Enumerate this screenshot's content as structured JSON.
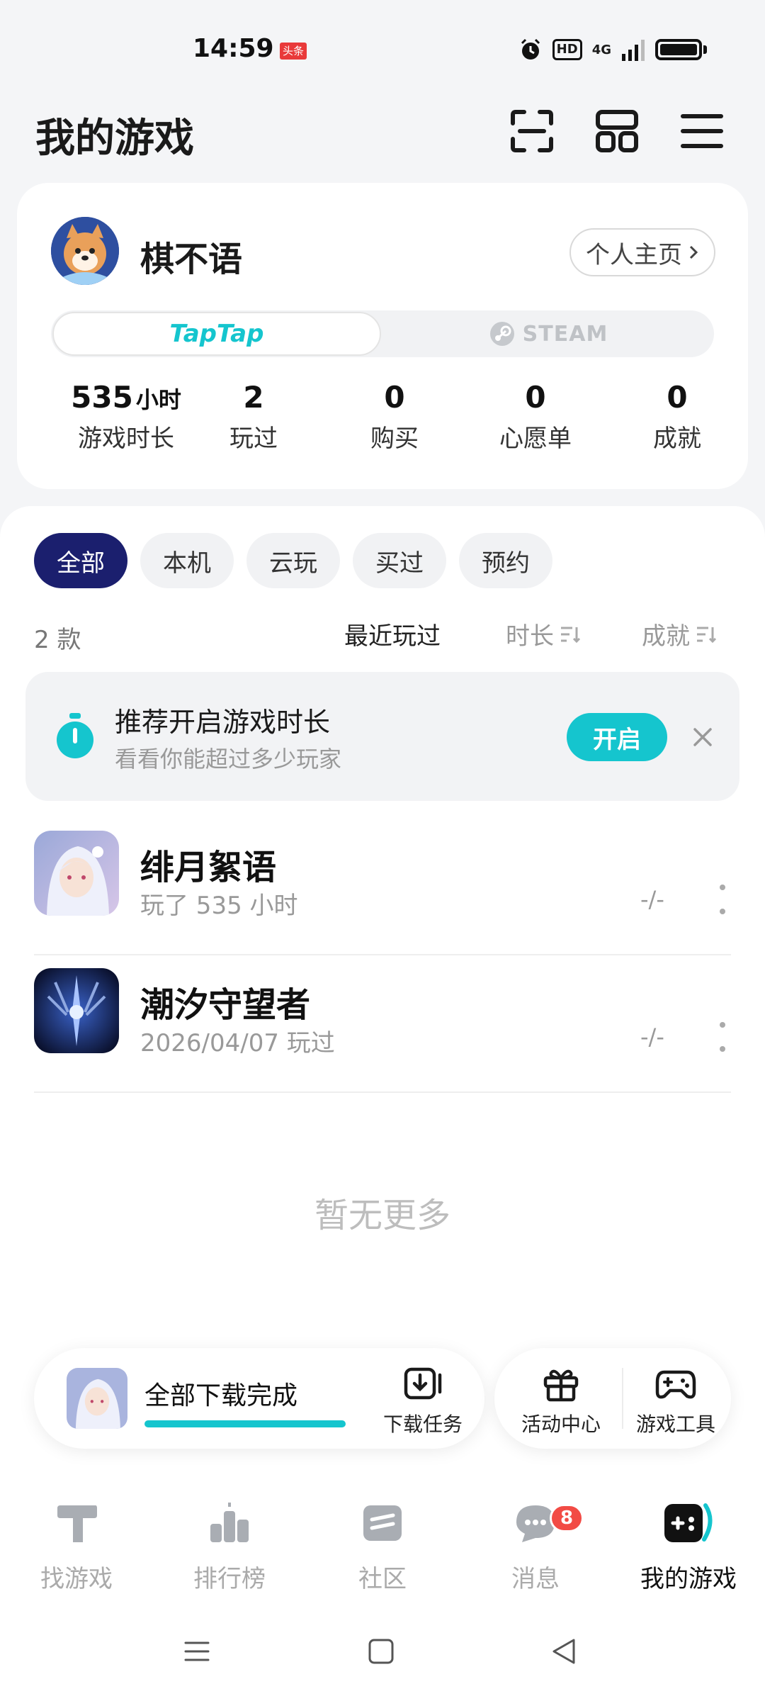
{
  "status_bar": {
    "time": "14:59",
    "news_badge": "头条",
    "hd": "HD",
    "network": "4G"
  },
  "header": {
    "title": "我的游戏",
    "icons": [
      "scan-icon",
      "layout-grid-icon",
      "menu-icon"
    ]
  },
  "profile": {
    "username": "棋不语",
    "home_button": "个人主页",
    "platforms": {
      "taptap": "TapTap",
      "steam": "STEAM"
    },
    "stats": [
      {
        "value": "535",
        "unit": "小时",
        "label": "游戏时长"
      },
      {
        "value": "2",
        "label": "玩过"
      },
      {
        "value": "0",
        "label": "购买"
      },
      {
        "value": "0",
        "label": "心愿单"
      },
      {
        "value": "0",
        "label": "成就"
      }
    ]
  },
  "filters": {
    "chips": [
      "全部",
      "本机",
      "云玩",
      "买过",
      "预约"
    ],
    "active": "全部"
  },
  "list_meta": {
    "count": "2 款",
    "sort": [
      "最近玩过",
      "时长",
      "成就"
    ]
  },
  "promo": {
    "title": "推荐开启游戏时长",
    "subtitle": "看看你能超过多少玩家",
    "button": "开启"
  },
  "games": [
    {
      "name": "绯月絮语",
      "sub": "玩了 535 小时",
      "rank": "-/-"
    },
    {
      "name": "潮汐守望者",
      "sub": "2026/04/07 玩过",
      "rank": "-/-"
    }
  ],
  "empty_text": "暂无更多",
  "download_bar": {
    "status": "全部下载完成",
    "progress": 1.0,
    "task_label": "下载任务"
  },
  "tools": {
    "activity": "活动中心",
    "game_tools": "游戏工具"
  },
  "bottom_nav": {
    "items": [
      {
        "label": "找游戏"
      },
      {
        "label": "排行榜"
      },
      {
        "label": "社区"
      },
      {
        "label": "消息",
        "badge": "8"
      },
      {
        "label": "我的游戏"
      }
    ],
    "active": "我的游戏"
  },
  "colors": {
    "accent": "#15c5ce",
    "chip_active": "#1b1f6e",
    "badge": "#f24b45"
  }
}
